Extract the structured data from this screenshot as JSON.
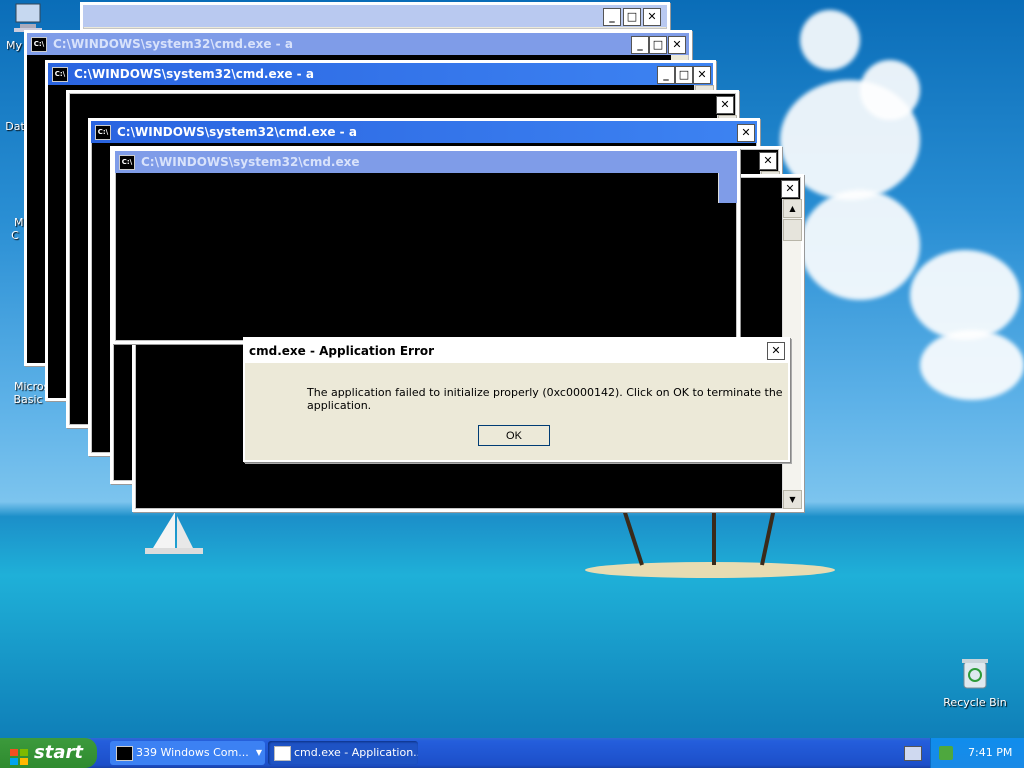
{
  "desktop": {
    "icons": [
      {
        "label": "My",
        "icon": "computer-icon"
      },
      {
        "label": "Dat",
        "icon": "folder-icon"
      },
      {
        "label": "Microsof\nC",
        "icon": "program-icon"
      },
      {
        "label": "Microsoft\nBasic",
        "icon": "program-icon"
      },
      {
        "label": "Recycle Bin",
        "icon": "recycle-bin-icon"
      }
    ]
  },
  "windows": {
    "w1": {
      "title": ""
    },
    "w2": {
      "title": "C:\\WINDOWS\\system32\\cmd.exe - a"
    },
    "w3": {
      "title": "C:\\WINDOWS\\system32\\cmd.exe - a"
    },
    "w4": {
      "title": "C:\\WINDOWS\\system32\\cmd.exe - a"
    },
    "w5": {
      "title": "C:\\WINDOWS\\system32\\cmd.exe"
    },
    "cmd_icon_text": "C:\\"
  },
  "dialog": {
    "title": "cmd.exe - Application Error",
    "message": "The application failed to initialize properly (0xc0000142). Click on OK to terminate the application.",
    "ok_label": "OK"
  },
  "taskbar": {
    "start_label": "start",
    "buttons": [
      {
        "label": "339 Windows Com...",
        "icon": "cmd-icon"
      },
      {
        "label": "cmd.exe - Application...",
        "icon": "window-icon"
      }
    ],
    "clock": "7:41 PM"
  },
  "colors": {
    "titlebar_active": "#2a64e0",
    "titlebar_inactive": "#7f9ce8",
    "taskbar": "#245edc",
    "start": "#3c9a3c"
  }
}
